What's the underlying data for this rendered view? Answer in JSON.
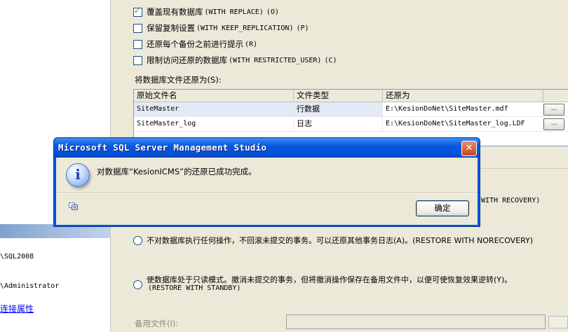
{
  "left": {
    "server": "\\SQL2008",
    "user": "\\Administrator",
    "link": "连接属性"
  },
  "options": {
    "overwrite": {
      "label": "覆盖现有数据库",
      "code": "(WITH REPLACE)",
      "key": "(O)",
      "checked": true
    },
    "keep_replication": {
      "label": "保留复制设置",
      "code": "(WITH KEEP_REPLICATION)",
      "key": "(P)",
      "checked": false
    },
    "prompt": {
      "label": "还原每个备份之前进行提示",
      "key": "(R)",
      "checked": false
    },
    "restricted": {
      "label": "限制访问还原的数据库",
      "code": "(WITH RESTRICTED_USER)",
      "key": "(C)",
      "checked": false
    }
  },
  "files": {
    "label": "将数据库文件还原为(S):",
    "headers": [
      "原始文件名",
      "文件类型",
      "还原为"
    ],
    "rows": [
      {
        "name": "SiteMaster",
        "type": "行数据",
        "restore_as": "E:\\KesionDoNet\\SiteMaster.mdf"
      },
      {
        "name": "SiteMaster_log",
        "type": "日志",
        "restore_as": "E:\\KesionDoNet\\SiteMaster_log.LDF"
      }
    ],
    "browse_label": "..."
  },
  "recovery": {
    "partial_text": "WITH RECOVERY)",
    "norecovery": "不对数据库执行任何操作，不回滚未提交的事务。可以还原其他事务日志(A)。(RESTORE WITH NORECOVERY)",
    "standby_line1": "使数据库处于只读模式。撤消未提交的事务，但将撤消操作保存在备用文件中，以便可使恢复效果逆转(Y)。",
    "standby_line2": "(RESTORE WITH STANDBY)",
    "standby_file_label": "备用文件(I):",
    "standby_file_value": ""
  },
  "dialog": {
    "title": "Microsoft SQL Server Management Studio",
    "message": "对数据库“KesionICMS”的还原已成功完成。",
    "ok_label": "确定",
    "close_glyph": "✕",
    "info_glyph": "i"
  },
  "icons": {
    "dialog_info": "info-icon",
    "copy": "copy-icon",
    "close": "close-icon"
  },
  "colors": {
    "titlebar": "#0054e3",
    "close_button": "#d7582a",
    "link": "#0000ff"
  }
}
